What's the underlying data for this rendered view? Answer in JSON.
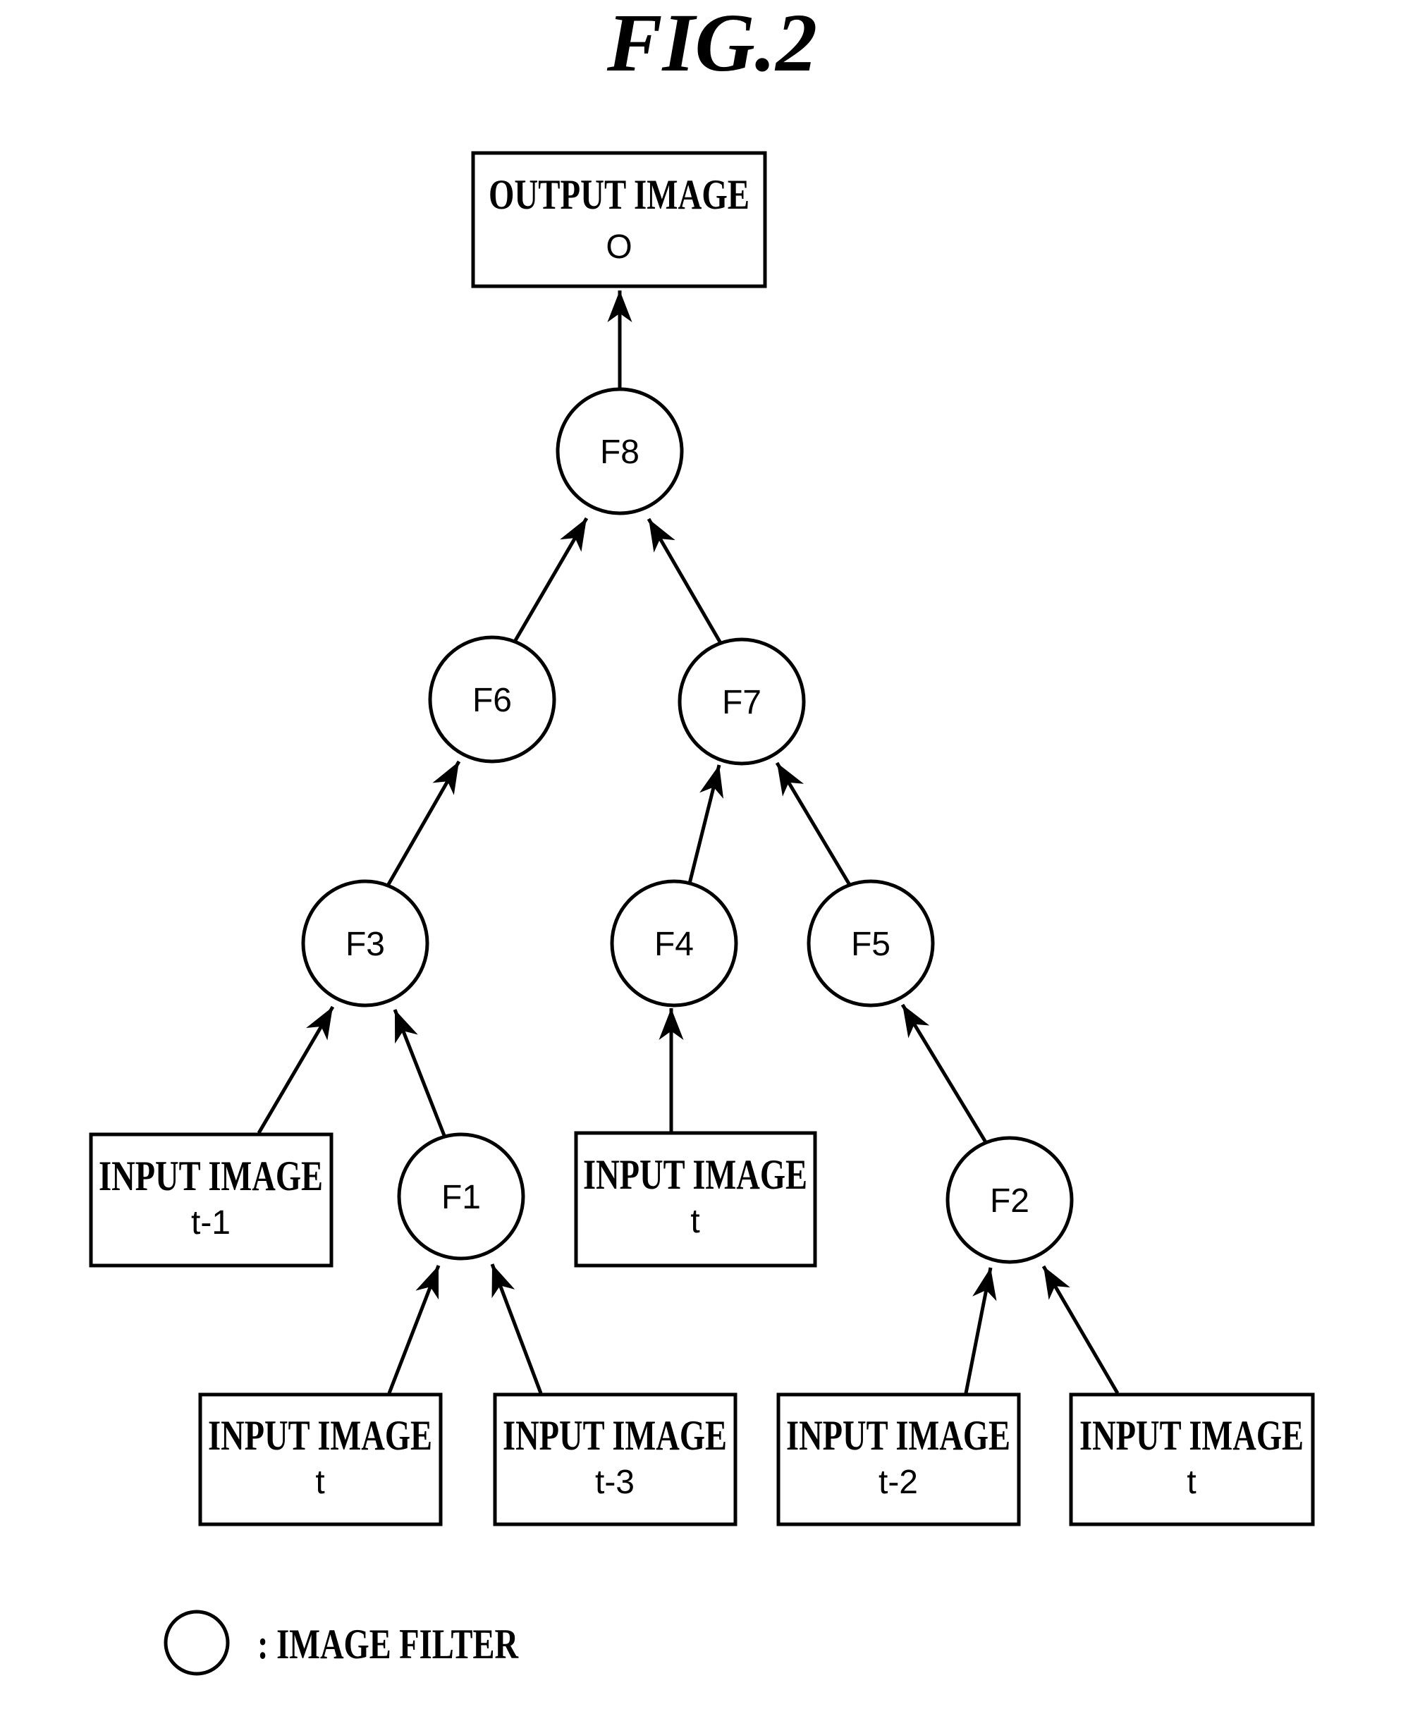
{
  "figure": {
    "title": "FIG.2"
  },
  "output": {
    "title": "OUTPUT IMAGE",
    "sub": "O"
  },
  "filters": {
    "F1": "F1",
    "F2": "F2",
    "F3": "F3",
    "F4": "F4",
    "F5": "F5",
    "F6": "F6",
    "F7": "F7",
    "F8": "F8"
  },
  "inputs": [
    {
      "title": "INPUT IMAGE",
      "sub": "t-1",
      "feeds": "F3"
    },
    {
      "title": "INPUT IMAGE",
      "sub": "t",
      "feeds": "F4"
    },
    {
      "title": "INPUT IMAGE",
      "sub": "t",
      "feeds": "F1"
    },
    {
      "title": "INPUT IMAGE",
      "sub": "t-3",
      "feeds": "F1"
    },
    {
      "title": "INPUT IMAGE",
      "sub": "t-2",
      "feeds": "F2"
    },
    {
      "title": "INPUT IMAGE",
      "sub": "t",
      "feeds": "F2"
    }
  ],
  "edges": [
    [
      "F8",
      "OUTPUT"
    ],
    [
      "F6",
      "F8"
    ],
    [
      "F7",
      "F8"
    ],
    [
      "F3",
      "F6"
    ],
    [
      "F4",
      "F7"
    ],
    [
      "F5",
      "F7"
    ],
    [
      "INPUT t-1",
      "F3"
    ],
    [
      "F1",
      "F3"
    ],
    [
      "INPUT t (middle)",
      "F4"
    ],
    [
      "F2",
      "F5"
    ],
    [
      "INPUT t (bottom-left)",
      "F1"
    ],
    [
      "INPUT t-3",
      "F1"
    ],
    [
      "INPUT t-2",
      "F2"
    ],
    [
      "INPUT t (bottom-right)",
      "F2"
    ]
  ],
  "legend": {
    "symbol": "circle",
    "text": ": IMAGE FILTER"
  }
}
